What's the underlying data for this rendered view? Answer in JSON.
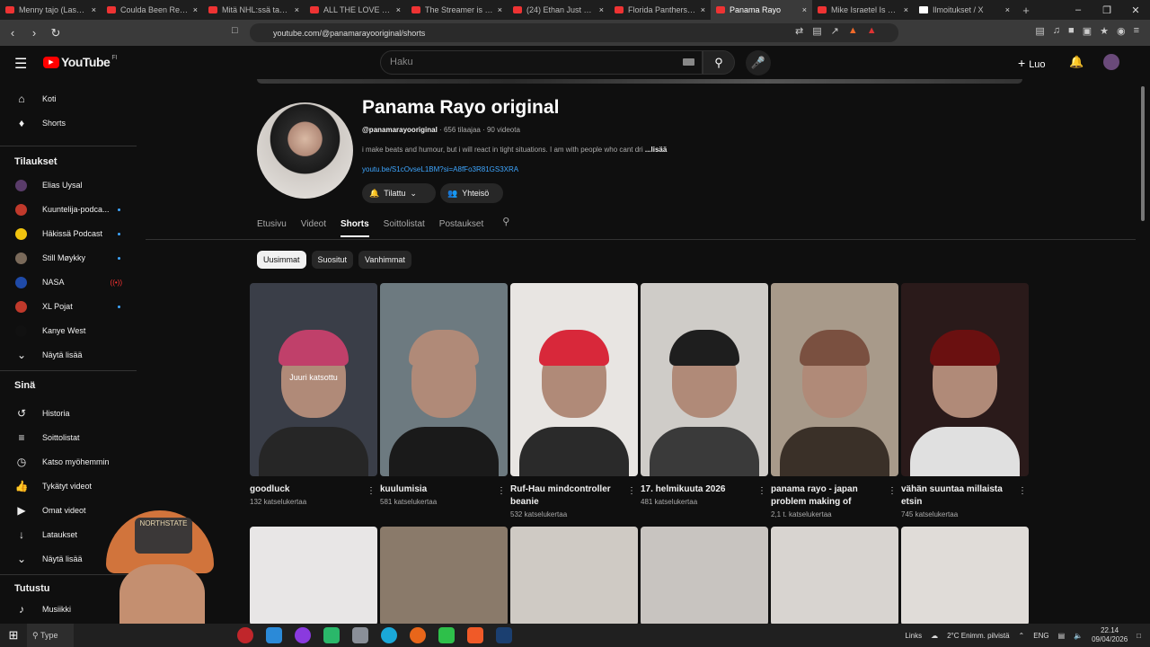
{
  "browser": {
    "tabs": [
      {
        "title": "Menny tajo (Laskelmat)",
        "favicon": "youtube-icon"
      },
      {
        "title": "Coulda Been Records",
        "favicon": "youtube-icon"
      },
      {
        "title": "Mitä NHL:ssä tapahtuu",
        "favicon": "youtube-icon"
      },
      {
        "title": "ALL THE LOVE (feat. A)",
        "favicon": "youtube-icon"
      },
      {
        "title": "The Streamer is out of",
        "favicon": "youtube-icon"
      },
      {
        "title": "(24) Ethan Just F**king",
        "favicon": "youtube-icon"
      },
      {
        "title": "Florida Panthers han",
        "favicon": "youtube-icon"
      },
      {
        "title": "Panama Rayo",
        "favicon": "youtube-icon",
        "active": true
      },
      {
        "title": "Mike Israetel Is Way To",
        "favicon": "youtube-icon"
      },
      {
        "title": "Ilmoitukset / X",
        "favicon": "x-icon"
      }
    ],
    "url": "youtube.com/@panamarayooriginal/shorts"
  },
  "header": {
    "logo": "YouTube",
    "region": "FI",
    "search_placeholder": "Haku",
    "create_label": "Luo"
  },
  "sidebar": {
    "main": [
      {
        "label": "Koti",
        "icon": "home-icon"
      },
      {
        "label": "Shorts",
        "icon": "shorts-icon"
      }
    ],
    "subs_heading": "Tilaukset",
    "subs": [
      {
        "label": "Elias Uysal",
        "color": "#5a3c6a",
        "badge": ""
      },
      {
        "label": "Kuuntelija-podca...",
        "color": "#c0392b",
        "badge": "dot"
      },
      {
        "label": "Häkissä Podcast",
        "color": "#f1c40f",
        "badge": "dot"
      },
      {
        "label": "Still Møykky",
        "color": "#7a6a5a",
        "badge": "dot"
      },
      {
        "label": "NASA",
        "color": "#1f4aa8",
        "badge": "live"
      },
      {
        "label": "XL Pojat",
        "color": "#c0392b",
        "badge": "dot"
      },
      {
        "label": "Kanye West",
        "color": "#111111",
        "badge": ""
      },
      {
        "label": "Näytä lisää",
        "color": "",
        "badge": ""
      }
    ],
    "you_heading": "Sinä",
    "you": [
      {
        "label": "Historia",
        "icon": "history-icon"
      },
      {
        "label": "Soittolistat",
        "icon": "playlist-icon"
      },
      {
        "label": "Katso myöhemmin",
        "icon": "clock-icon"
      },
      {
        "label": "Tykätyt videot",
        "icon": "thumbs-up-icon"
      },
      {
        "label": "Omat videot",
        "icon": "video-icon"
      },
      {
        "label": "Lataukset",
        "icon": "download-icon"
      },
      {
        "label": "Näytä lisää",
        "icon": "chevron-down-icon"
      }
    ],
    "explore_heading": "Tutustu",
    "explore": [
      {
        "label": "Musiikki",
        "icon": "music-icon"
      }
    ]
  },
  "channel": {
    "name": "Panama Rayo original",
    "handle": "@panamarayooriginal",
    "meta": " · 656 tilaajaa · 90 videota",
    "description": "i make beats and humour, but i will react in tight situations. I am with people who cant dri",
    "more": "...lisää",
    "link": "youtu.be/S1cOvseL1BM?si=A8fFo3R81GS3XRA",
    "subscribe_label": "Tilattu",
    "community_label": "Yhteisö"
  },
  "tabs": [
    "Etusivu",
    "Videot",
    "Shorts",
    "Soittolistat",
    "Postaukset"
  ],
  "active_tab": "Shorts",
  "chips": [
    "Uusimmat",
    "Suositut",
    "Vanhimmat"
  ],
  "shorts": [
    {
      "title": "goodluck",
      "views": "132 katselukertaa",
      "overlay": "Juuri katsottu",
      "bg": "#3a3e48",
      "hat": "#c0406a",
      "shirt": "#262626"
    },
    {
      "title": "kuulumisia",
      "views": "581 katselukertaa",
      "overlay": "",
      "bg": "#6d7a80",
      "hat": "#b08a78",
      "shirt": "#1a1a1a"
    },
    {
      "title": "Ruf-Hau mindcontroller beanie",
      "views": "532 katselukertaa",
      "overlay": "",
      "bg": "#e8e5e2",
      "hat": "#d8283a",
      "shirt": "#2a2a2a"
    },
    {
      "title": "17. helmikuuta 2026",
      "views": "481 katselukertaa",
      "overlay": "",
      "bg": "#cfccc8",
      "hat": "#1e1e1e",
      "shirt": "#3a3a3a"
    },
    {
      "title": "panama rayo - japan problem making of",
      "views": "2,1 t. katselukertaa",
      "overlay": "",
      "bg": "#a89a8a",
      "hat": "#7a5040",
      "shirt": "#3a3028"
    },
    {
      "title": "vähän suuntaa millaista etsin",
      "views": "745 katselukertaa",
      "overlay": "",
      "bg": "#2a1a1a",
      "hat": "#6a1010",
      "shirt": "#e0e0e0"
    }
  ],
  "shorts_row2": [
    {
      "bg": "#e8e6e6",
      "hat": "#d83a2a"
    },
    {
      "bg": "#8a7a6a",
      "hat": "#4a3a30"
    },
    {
      "bg": "#cfcac4",
      "hat": "#3a3a3a"
    },
    {
      "bg": "#c8c4c0",
      "hat": "#2a2a2a"
    },
    {
      "bg": "#d8d4d0",
      "hat": "#1a1a1a"
    },
    {
      "bg": "#e0dcd8",
      "hat": "#2a2a2a"
    }
  ],
  "webcam": {
    "cap_text": "NORTHSTATE"
  },
  "taskbar": {
    "search": "Type",
    "weather": "2°C  Enimm. pilvistä",
    "links": "Links",
    "lang": "ENG",
    "time": "22.14",
    "date": "09/04/2026"
  }
}
